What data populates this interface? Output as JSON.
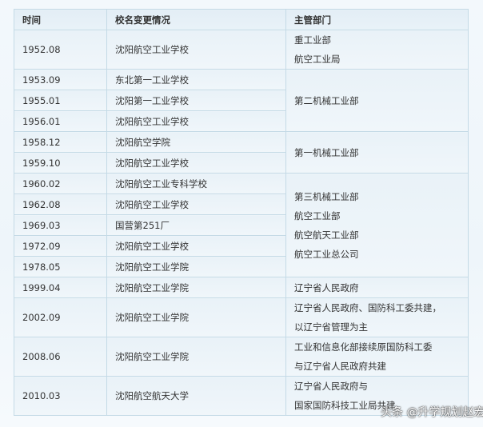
{
  "headers": [
    "时间",
    "校名变更情况",
    "主管部门"
  ],
  "rows": [
    {
      "time": "1952.08",
      "name": "沈阳航空工业学校"
    },
    {
      "time": "1953.09",
      "name": "东北第一工业学校"
    },
    {
      "time": "1955.01",
      "name": "沈阳第一工业学校"
    },
    {
      "time": "1956.01",
      "name": "沈阳航空工业学校"
    },
    {
      "time": "1958.12",
      "name": "沈阳航空学院"
    },
    {
      "time": "1959.10",
      "name": "沈阳航空工业学校"
    },
    {
      "time": "1960.02",
      "name": "沈阳航空工业专科学校"
    },
    {
      "time": "1962.08",
      "name": "沈阳航空工业学校"
    },
    {
      "time": "1969.03",
      "name": "国营第251厂"
    },
    {
      "time": "1972.09",
      "name": "沈阳航空工业学校"
    },
    {
      "time": "1978.05",
      "name": "沈阳航空工业学院"
    },
    {
      "time": "1999.04",
      "name": "沈阳航空工业学院"
    },
    {
      "time": "2002.09",
      "name": "沈阳航空工业学院"
    },
    {
      "time": "2008.06",
      "name": "沈阳航空工业学院"
    },
    {
      "time": "2010.03",
      "name": "沈阳航空航天大学"
    }
  ],
  "departments": [
    [
      "重工业部",
      "航空工业局"
    ],
    [
      "第二机械工业部"
    ],
    [
      "第一机械工业部"
    ],
    [
      "第三机械工业部",
      "航空工业部",
      "航空航天工业部",
      "航空工业总公司"
    ],
    [
      "辽宁省人民政府"
    ],
    [
      "辽宁省人民政府、国防科工委共建，",
      "以辽宁省管理为主"
    ],
    [
      "工业和信息化部接续原国防科工委",
      "与辽宁省人民政府共建"
    ],
    [
      "辽宁省人民政府与",
      "国家国防科技工业局共建"
    ]
  ],
  "watermark": "头条 @升学规划赵宏"
}
